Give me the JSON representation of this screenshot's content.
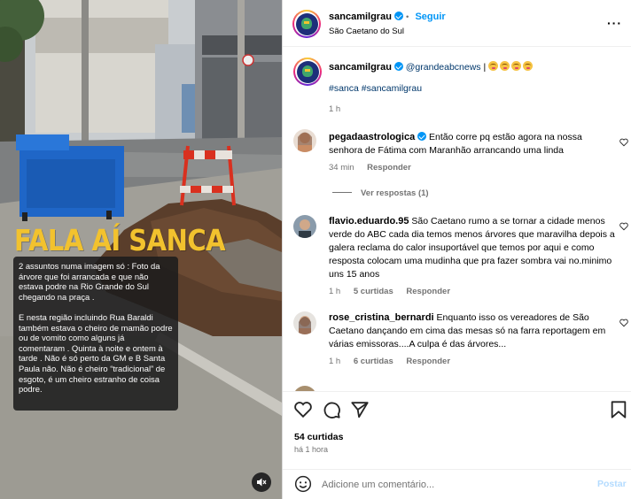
{
  "media": {
    "headline": "FALA AÍ SANCA",
    "overlay_paragraphs": [
      "2 assuntos numa imagem só : Foto da árvore que foi arrancada e que não estava podre na Rio Grande do Sul chegando na praça .",
      "E nesta região incluindo Rua Baraldi também estava o cheiro de mamão podre ou de vomito como alguns já comentaram . Quinta à noite e ontem à tarde . Não é só perto da GM e B Santa Paula não. Não é cheiro “tradicional” de esgoto, é um cheiro estranho de coisa podre."
    ],
    "mute_icon": "speaker-muted-icon"
  },
  "header": {
    "username": "sancamilgrau",
    "follow_label": "Seguir",
    "separator": "•",
    "location": "São Caetano do Sul",
    "more_icon": "more-horizontal-icon"
  },
  "caption": {
    "username": "sancamilgrau",
    "mention": "@grandeabcnews",
    "separator": "|",
    "emoji_count": 4,
    "hashtags": [
      "#sanca",
      "#sancamilgrau"
    ],
    "time": "1 h"
  },
  "comments": [
    {
      "username": "pegadaastrologica",
      "verified": true,
      "text": "Então corre pq estão agora na nossa senhora de Fátima com Maranhão arrancando uma linda",
      "time": "34 min",
      "likes": "",
      "reply_label": "Responder",
      "view_replies": "Ver respostas (1)"
    },
    {
      "username": "flavio.eduardo.95",
      "verified": false,
      "text": "São Caetano rumo a se tornar a cidade menos verde do ABC cada dia temos menos árvores que maravilha depois a galera reclama do calor insuportável que temos por aqui e como resposta colocam uma mudinha que pra fazer sombra vai no.minimo uns 15 anos",
      "time": "1 h",
      "likes": "5 curtidas",
      "reply_label": "Responder"
    },
    {
      "username": "rose_cristina_bernardi",
      "verified": false,
      "text": "Enquanto isso os vereadores de São Caetano dançando em cima das mesas só na farra reportagem em várias emissoras....A culpa é das árvores...",
      "time": "1 h",
      "likes": "6 curtidas",
      "reply_label": "Responder"
    }
  ],
  "actions": {
    "likes": "54 curtidas",
    "time_ago": "há 1 hora"
  },
  "comment_bar": {
    "placeholder": "Adicione um comentário...",
    "post_label": "Postar"
  },
  "colors": {
    "accent_blue": "#0095f6",
    "link_blue": "#00376b",
    "muted_gray": "#737373",
    "headline_yellow": "#f2c22e"
  }
}
